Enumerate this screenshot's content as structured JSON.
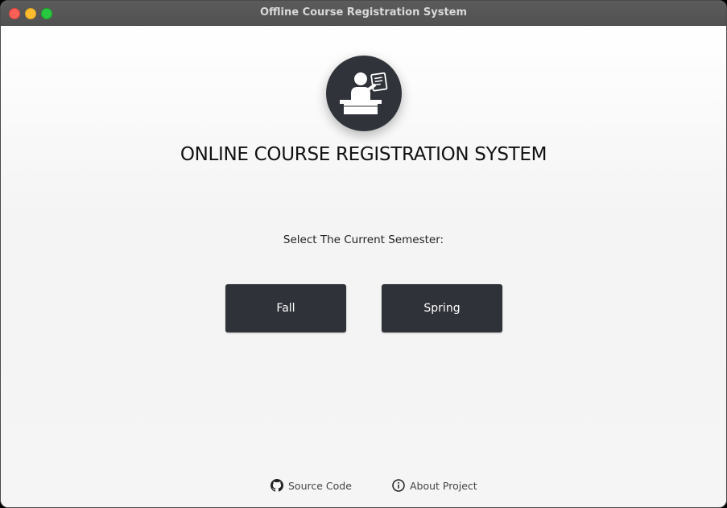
{
  "window": {
    "title": "Offline Course Registration System"
  },
  "main": {
    "heading": "ONLINE COURSE REGISTRATION SYSTEM",
    "logo_icon": "presenter-document-icon",
    "semester_prompt": "Select The Current Semester:",
    "semester_options": [
      {
        "label": "Fall"
      },
      {
        "label": "Spring"
      }
    ]
  },
  "footer": {
    "links": [
      {
        "label": "Source Code",
        "icon": "github-icon"
      },
      {
        "label": "About Project",
        "icon": "info-icon"
      }
    ]
  },
  "colors": {
    "button_bg": "#2f3238",
    "logo_bg": "#30333a",
    "window_bg": "#f6f6f6",
    "titlebar_bg": "#555555"
  }
}
